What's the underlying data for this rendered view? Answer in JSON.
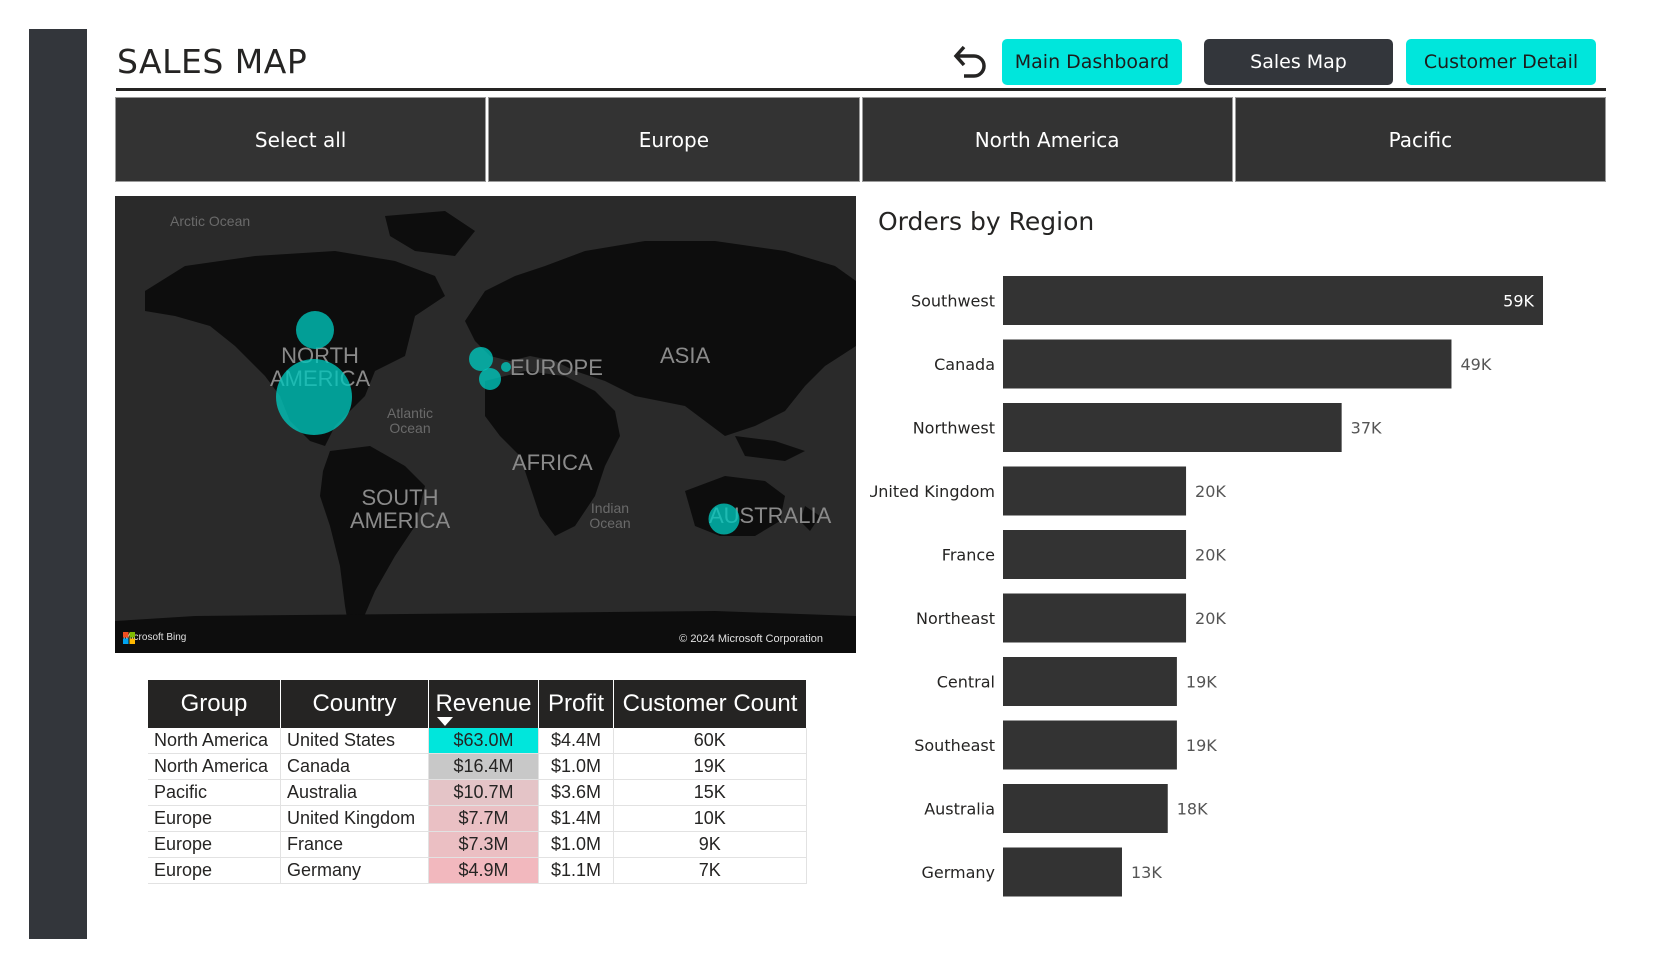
{
  "header": {
    "title": "SALES MAP",
    "nav_buttons": [
      {
        "label": "Main Dashboard",
        "style": "cyan"
      },
      {
        "label": "Sales Map",
        "style": "dark"
      },
      {
        "label": "Customer Detail",
        "style": "cyan"
      }
    ],
    "back_icon": "undo-arrow-icon"
  },
  "slicer": {
    "items": [
      "Select all",
      "Europe",
      "North America",
      "Pacific"
    ]
  },
  "map": {
    "continent_labels": [
      "NORTH AMERICA",
      "EUROPE",
      "ASIA",
      "AFRICA",
      "SOUTH AMERICA",
      "AUSTRALIA"
    ],
    "ocean_labels": [
      "Arctic Ocean",
      "Atlantic Ocean",
      "Indian Ocean"
    ],
    "attribution": "Microsoft Bing",
    "copyright": "© 2024 Microsoft Corporation",
    "bubble_color": "#00c8be"
  },
  "table": {
    "headers": [
      "Group",
      "Country",
      "Revenue",
      "Profit",
      "Customer Count"
    ],
    "sorted_column": "Revenue",
    "rows": [
      {
        "group": "North America",
        "country": "United States",
        "revenue": "$63.0M",
        "profit": "$4.4M",
        "customers": "60K",
        "revenue_color": "#00e6dc"
      },
      {
        "group": "North America",
        "country": "Canada",
        "revenue": "$16.4M",
        "profit": "$1.0M",
        "customers": "19K",
        "revenue_color": "#c8c8c8"
      },
      {
        "group": "Pacific",
        "country": "Australia",
        "revenue": "$10.7M",
        "profit": "$3.6M",
        "customers": "15K",
        "revenue_color": "#e4c4c7"
      },
      {
        "group": "Europe",
        "country": "United Kingdom",
        "revenue": "$7.7M",
        "profit": "$1.4M",
        "customers": "10K",
        "revenue_color": "#eac0c4"
      },
      {
        "group": "Europe",
        "country": "France",
        "revenue": "$7.3M",
        "profit": "$1.0M",
        "customers": "9K",
        "revenue_color": "#ebbfc3"
      },
      {
        "group": "Europe",
        "country": "Germany",
        "revenue": "$4.9M",
        "profit": "$1.1M",
        "customers": "7K",
        "revenue_color": "#f2b8be"
      }
    ]
  },
  "chart_data": {
    "type": "bar",
    "orientation": "horizontal",
    "title": "Orders by Region",
    "categories": [
      "Southwest",
      "Canada",
      "Northwest",
      "United Kingdom",
      "France",
      "Northeast",
      "Central",
      "Southeast",
      "Australia",
      "Germany"
    ],
    "values": [
      59,
      49,
      37,
      20,
      20,
      20,
      19,
      19,
      18,
      13
    ],
    "value_labels": [
      "59K",
      "49K",
      "37K",
      "20K",
      "20K",
      "20K",
      "19K",
      "19K",
      "18K",
      "13K"
    ],
    "unit": "K",
    "bar_color": "#333333",
    "grid": false
  }
}
